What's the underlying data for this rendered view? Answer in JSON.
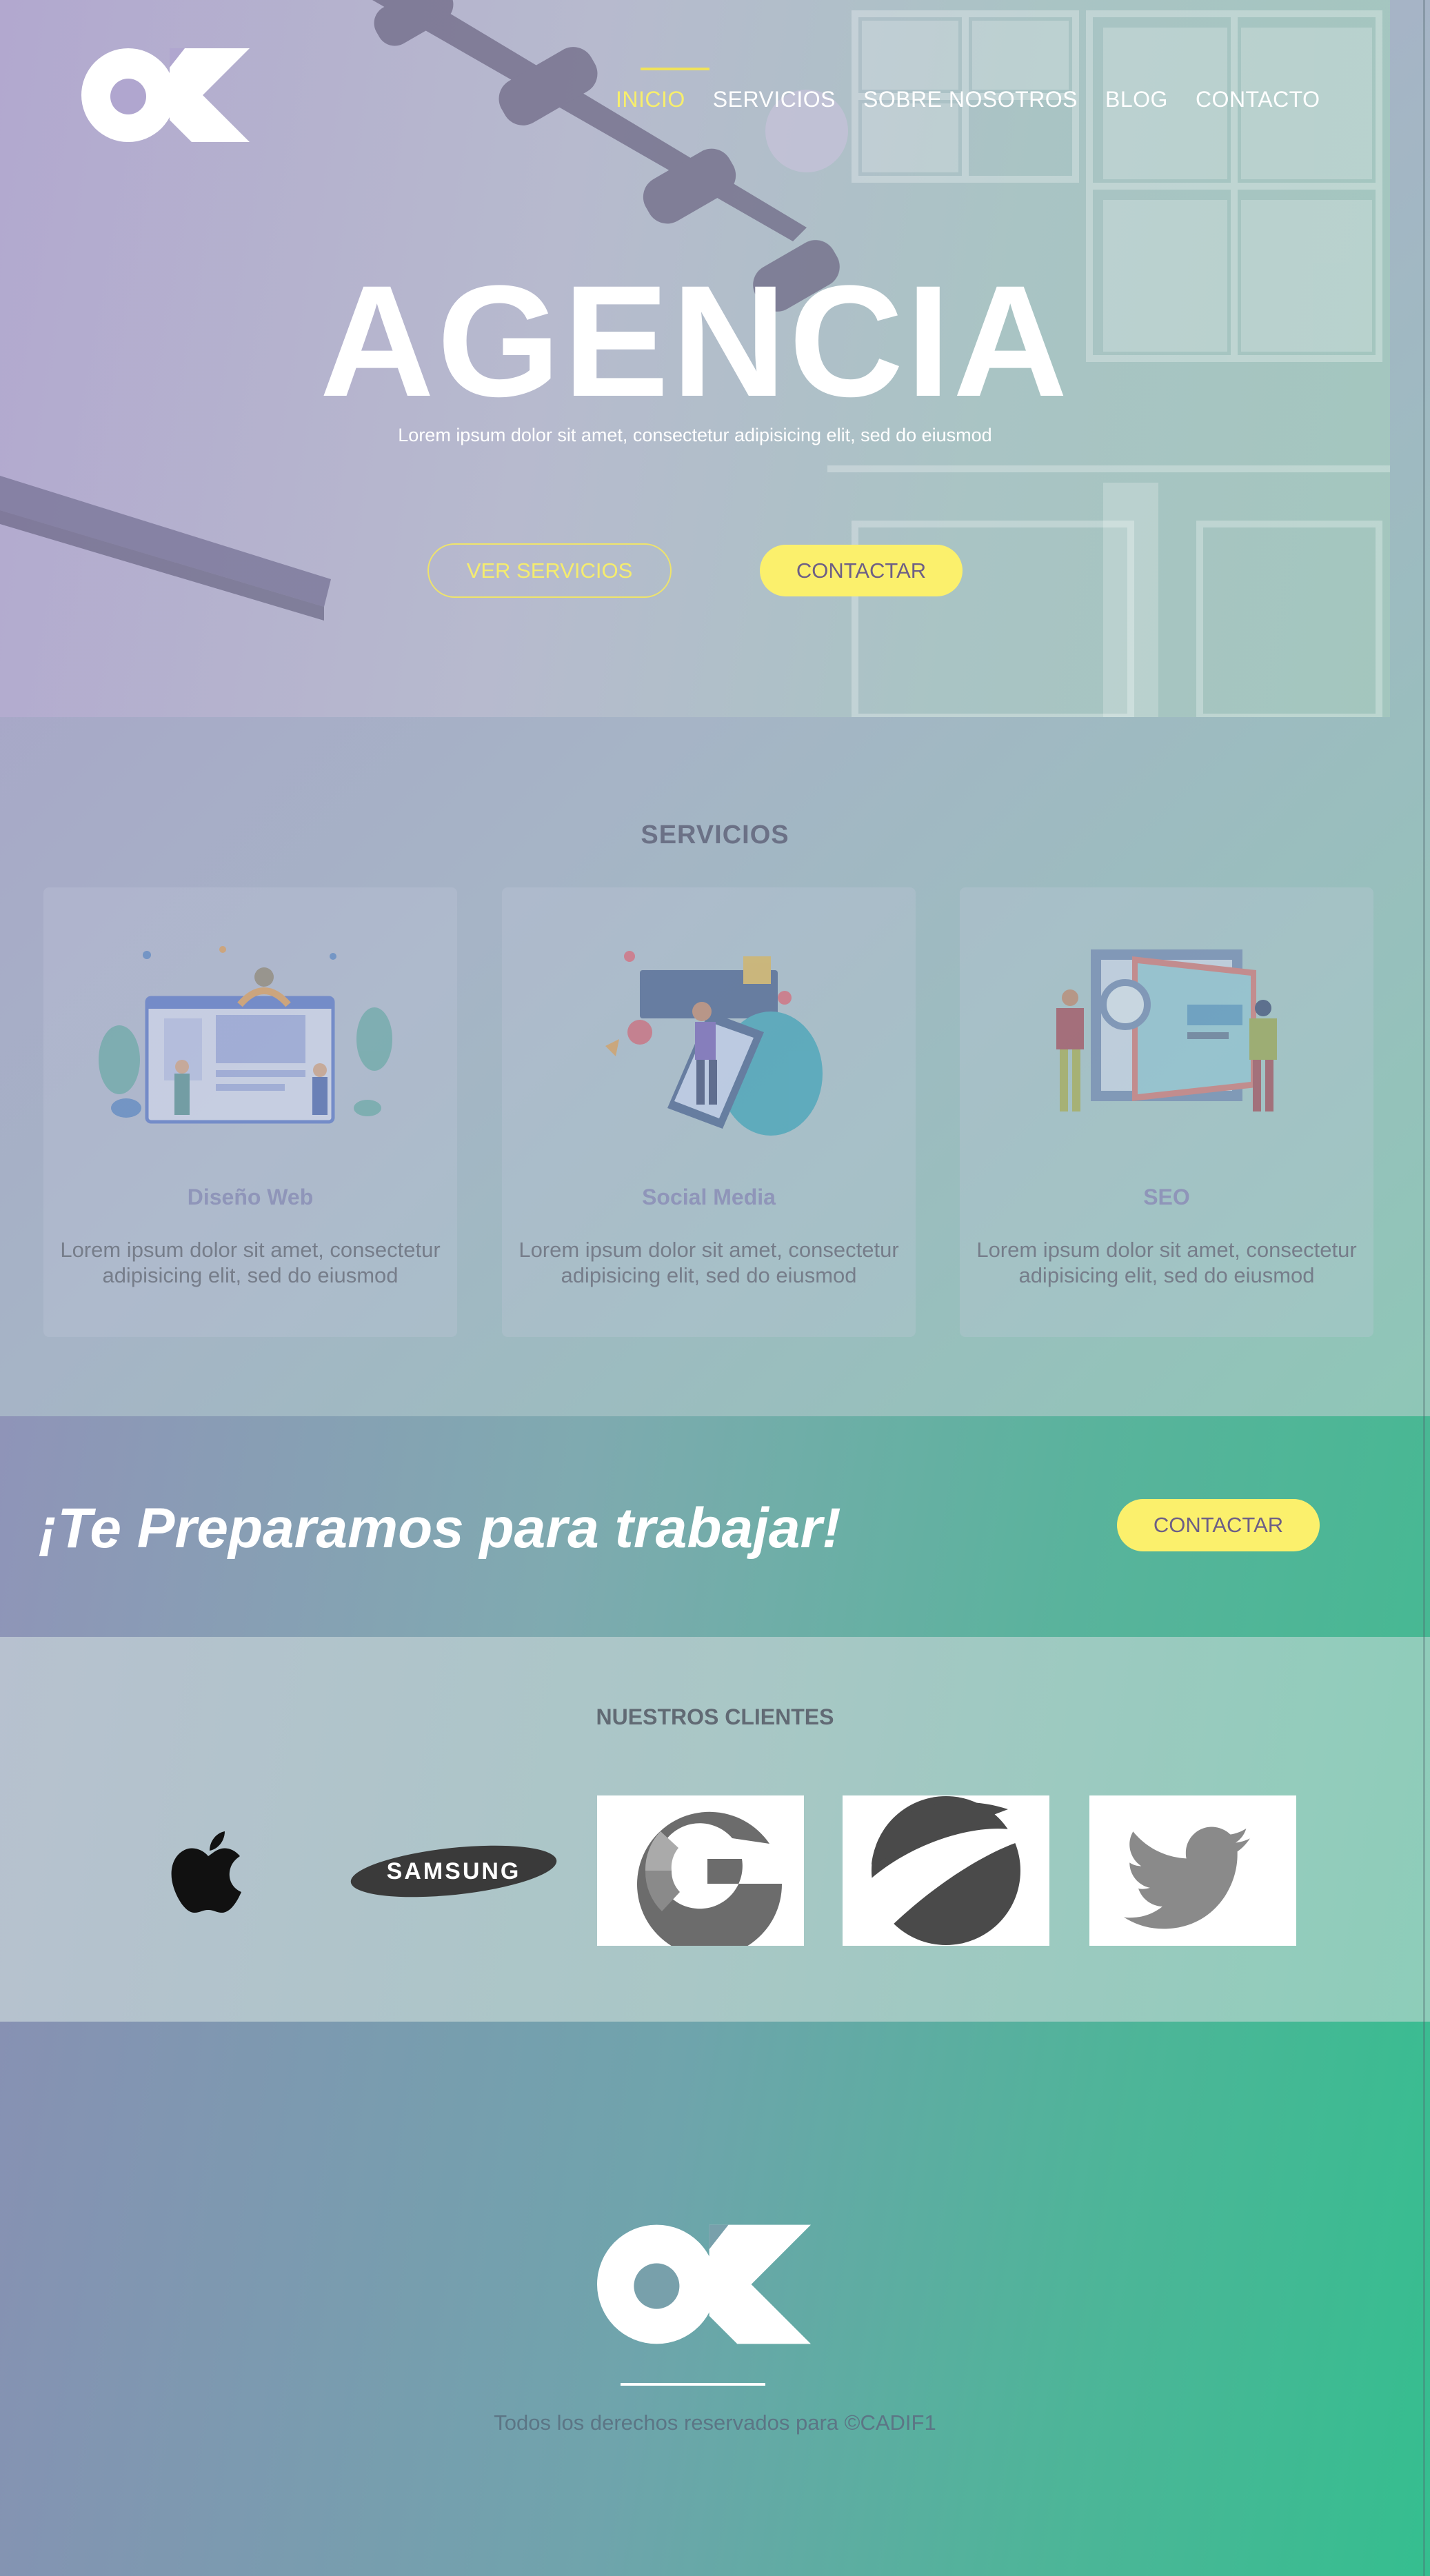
{
  "brand": {
    "logo_text": "OK",
    "accent_color": "#fbf06c"
  },
  "nav": {
    "items": [
      {
        "label": "INICIO",
        "active": true
      },
      {
        "label": "SERVICIOS",
        "active": false
      },
      {
        "label": "SOBRE NOSOTROS",
        "active": false
      },
      {
        "label": "BLOG",
        "active": false
      },
      {
        "label": "CONTACTO",
        "active": false
      }
    ]
  },
  "hero": {
    "title": "AGENCIA",
    "subtitle": "Lorem ipsum dolor sit amet, consectetur adipisicing elit, sed do eiusmod",
    "btn_services": "VER SERVICIOS",
    "btn_contact": "CONTACTAR"
  },
  "services": {
    "title": "SERVICIOS",
    "cards": [
      {
        "title": "Diseño Web",
        "text": "Lorem ipsum dolor sit amet, consectetur adipisicing elit, sed do eiusmod",
        "icon": "web-design-illustration"
      },
      {
        "title": "Social Media",
        "text": "Lorem ipsum dolor sit amet, consectetur adipisicing elit, sed do eiusmod",
        "icon": "social-media-illustration"
      },
      {
        "title": "SEO",
        "text": "Lorem ipsum dolor sit amet, consectetur adipisicing elit, sed do eiusmod",
        "icon": "seo-illustration"
      }
    ]
  },
  "cta": {
    "text": "¡Te Preparamos para trabajar!",
    "button": "CONTACTAR"
  },
  "clients": {
    "title": "NUESTROS CLIENTES",
    "logos": [
      "apple-logo",
      "samsung-logo",
      "google-logo",
      "pepsi-logo",
      "twitter-logo"
    ],
    "samsung_text": "SAMSUNG"
  },
  "footer": {
    "copyright": "Todos los derechos reservados para ©CADIF1"
  }
}
